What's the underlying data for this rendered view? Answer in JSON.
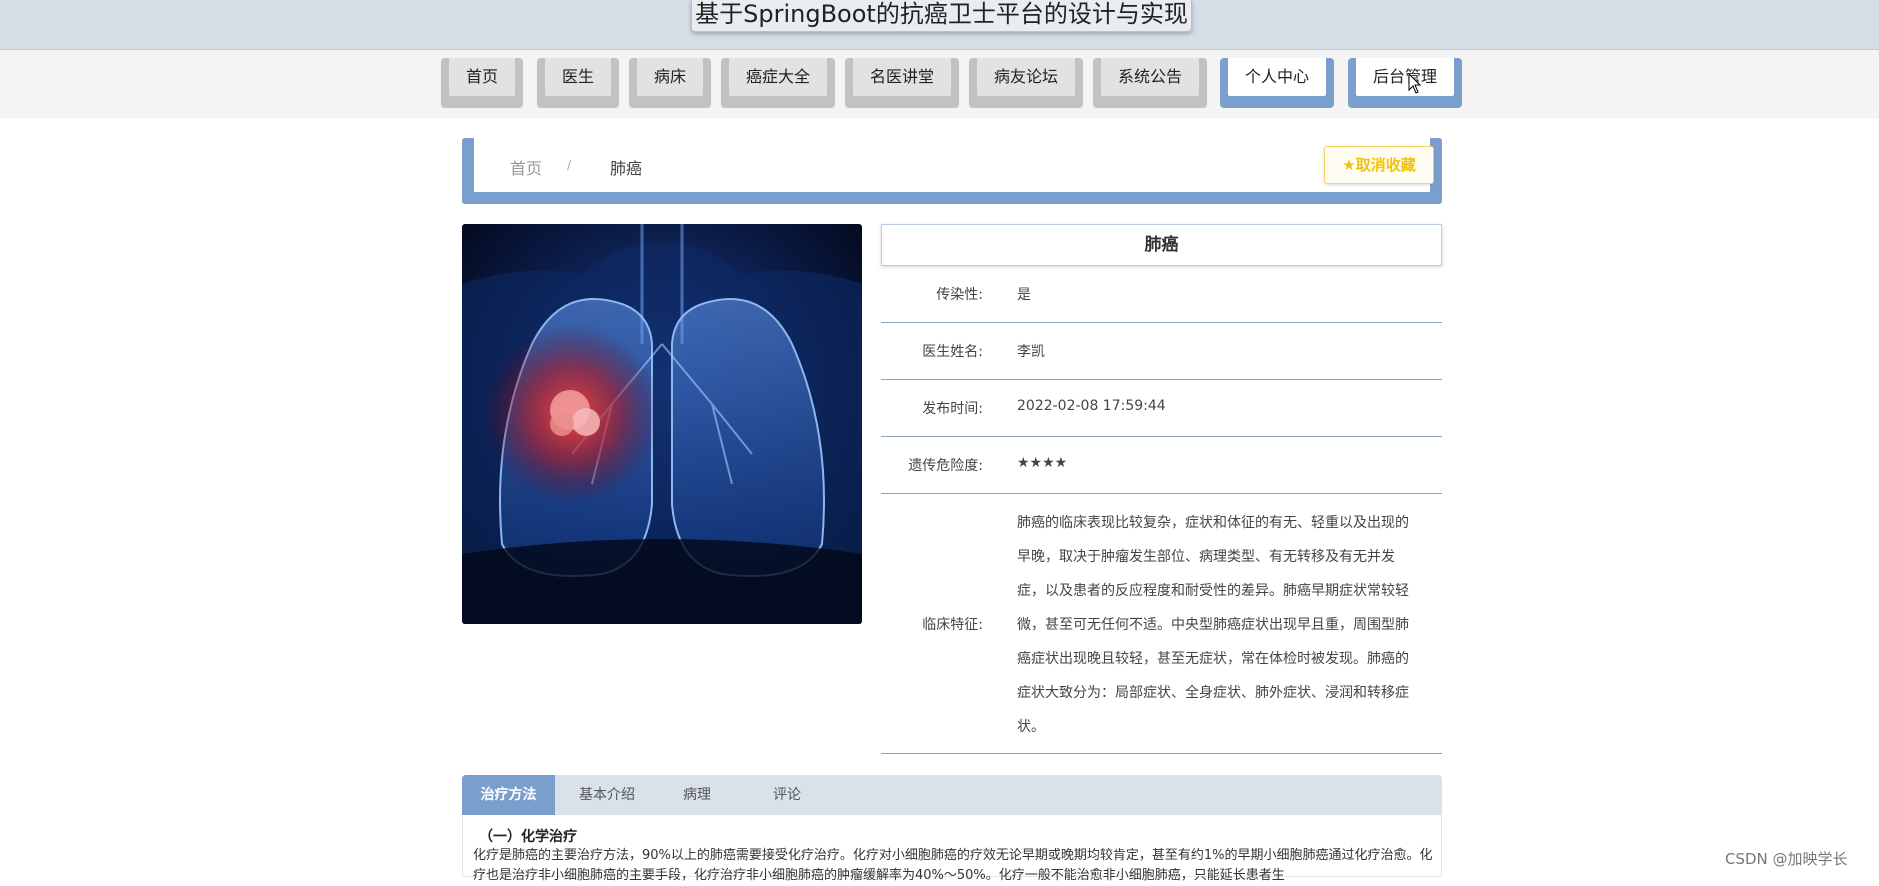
{
  "header": {
    "title": "基于SpringBoot的抗癌卫士平台的设计与实现"
  },
  "nav": {
    "items": [
      {
        "label": "首页",
        "active": false
      },
      {
        "label": "医生",
        "active": false
      },
      {
        "label": "病床",
        "active": false
      },
      {
        "label": "癌症大全",
        "active": false
      },
      {
        "label": "名医讲堂",
        "active": false
      },
      {
        "label": "病友论坛",
        "active": false
      },
      {
        "label": "系统公告",
        "active": false
      },
      {
        "label": "个人中心",
        "active": true
      },
      {
        "label": "后台管理",
        "active": true
      }
    ]
  },
  "breadcrumb": {
    "home": "首页",
    "separator": "/",
    "current": "肺癌"
  },
  "favorite": {
    "label": "取消收藏",
    "icon": "star-icon"
  },
  "detail": {
    "title": "肺癌",
    "fields": {
      "contagious_label": "传染性:",
      "contagious": "是",
      "doctor_label": "医生姓名:",
      "doctor": "李凯",
      "time_label": "发布时间:",
      "time": "2022-02-08 17:59:44",
      "risk_label": "遗传危险度:",
      "risk": "★★★★",
      "clinical_label": "临床特征:",
      "clinical": "肺癌的临床表现比较复杂，症状和体征的有无、轻重以及出现的早晚，取决于肿瘤发生部位、病理类型、有无转移及有无并发症，以及患者的反应程度和耐受性的差异。肺癌早期症状常较轻微，甚至可无任何不适。中央型肺癌症状出现早且重，周围型肺癌症状出现晚且较轻，甚至无症状，常在体检时被发现。肺癌的症状大致分为：局部症状、全身症状、肺外症状、浸润和转移症状。"
    }
  },
  "tabs": {
    "items": [
      "治疗方法",
      "基本介绍",
      "病理",
      "评论"
    ],
    "active_index": 0,
    "content_heading": "（一）化学治疗",
    "content_text": "化疗是肺癌的主要治疗方法，90%以上的肺癌需要接受化疗治疗。化疗对小细胞肺癌的疗效无论早期或晚期均较肯定，甚至有约1%的早期小细胞肺癌通过化疗治愈。化疗也是治疗非小细胞肺癌的主要手段，化疗治疗非小细胞肺癌的肿瘤缓解率为40%～50%。化疗一般不能治愈非小细胞肺癌，只能延长患者生"
  },
  "watermark": "CSDN @加映学长",
  "colors": {
    "accent": "#7b9fcc",
    "favorite": "#f2c30e",
    "nav_inactive": "#c2c2c2"
  }
}
